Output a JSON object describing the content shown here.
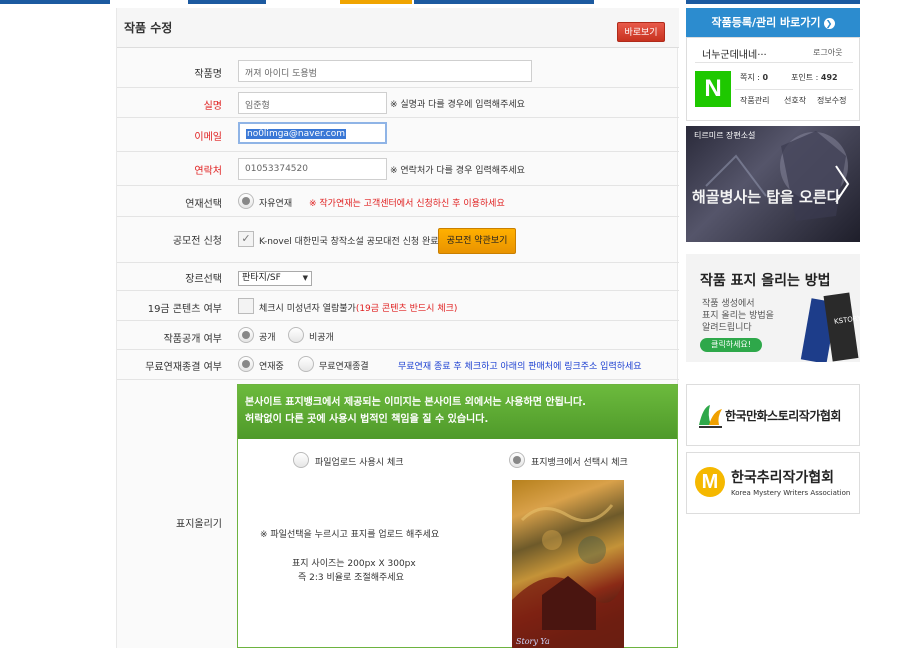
{
  "header": {
    "title": "작품 수정",
    "preview_button": "바로보기"
  },
  "form": {
    "work_name": {
      "label": "작품명",
      "value": "꺼져 아이디 도용범"
    },
    "real_name": {
      "label": "실명",
      "value": "임준형",
      "note": "※ 실명과 다를 경우에 입력해주세요"
    },
    "email": {
      "label": "이메일",
      "value": "no0limga@naver.com"
    },
    "phone": {
      "label": "연락처",
      "value": "01053374520",
      "note": "※ 연락처가 다를 경우 입력해주세요"
    },
    "serial": {
      "label": "연재선택",
      "option": "자유연재",
      "note": "※ 작가연재는 고객센터에서 신청하신 후 이용하세요"
    },
    "contest": {
      "label": "공모전 신청",
      "text": "K-novel 대한민국 창작소설 공모대전 신청 완료",
      "button": "공모전 약관보기"
    },
    "genre": {
      "label": "장르선택",
      "selected": "판타지/SF"
    },
    "adult": {
      "label": "19금 콘텐츠 여부",
      "text": "체크시 미성년자 열람불가",
      "note": "(19금 콘텐츠 반드시 체크)"
    },
    "public": {
      "label": "작품공개 여부",
      "options": [
        "공개",
        "비공개"
      ]
    },
    "free_end": {
      "label": "무료연재종결 여부",
      "options": [
        "연재중",
        "무료연재종결"
      ],
      "note": "무료연재 종료 후 체크하고 아래의 판매처에 링크주소 입력하세요"
    },
    "cover": {
      "label": "표지올리기",
      "notice_line1": "본사이트 표지뱅크에서 제공되는 이미지는 본사이트 외에서는 사용하면 안됩니다.",
      "notice_line2": "허락없이 다른 곳에 사용시 법적인 책임을 질 수 있습니다.",
      "option_upload": "파일업로드 사용시 체크",
      "option_bank": "표지뱅크에서 선택시 체크",
      "instruction": "※ 파일선택을 누르시고 표지를 업로드 해주세요",
      "size_line1": "표지 사이즈는 200px X 300px",
      "size_line2": "즉 2:3 비율로 조절해주세요",
      "image_caption": "Story Ya"
    }
  },
  "sidebar": {
    "header": "작품등록/관리 바로가기",
    "username": "너누군데내네···",
    "logout": "로그아웃",
    "note_label": "쪽지 : ",
    "note_count": "0",
    "point_label": "포인트 : ",
    "point_value": "492",
    "links": [
      "작품관리",
      "선호작",
      "정보수정"
    ],
    "banner1_badge": "티르미르 장편소설",
    "banner1_title": "해골병사는 탑을 오른다",
    "banner2_title": "작품 표지 올리는 방법",
    "banner2_line1": "작품 생성에서",
    "banner2_line2": "표지 올리는 방법을",
    "banner2_line3": "알려드립니다",
    "banner2_button": "클릭하세요!",
    "banner2_book": "KSTORY",
    "assoc1": "한국만화스토리작가협회",
    "assoc2": "한국추리작가협회",
    "assoc2_en": "Korea Mystery Writers Association"
  },
  "colors": {
    "accent_blue": "#2c8ccf",
    "green": "#5aa832",
    "red": "#e02020",
    "naver": "#1ec800"
  }
}
